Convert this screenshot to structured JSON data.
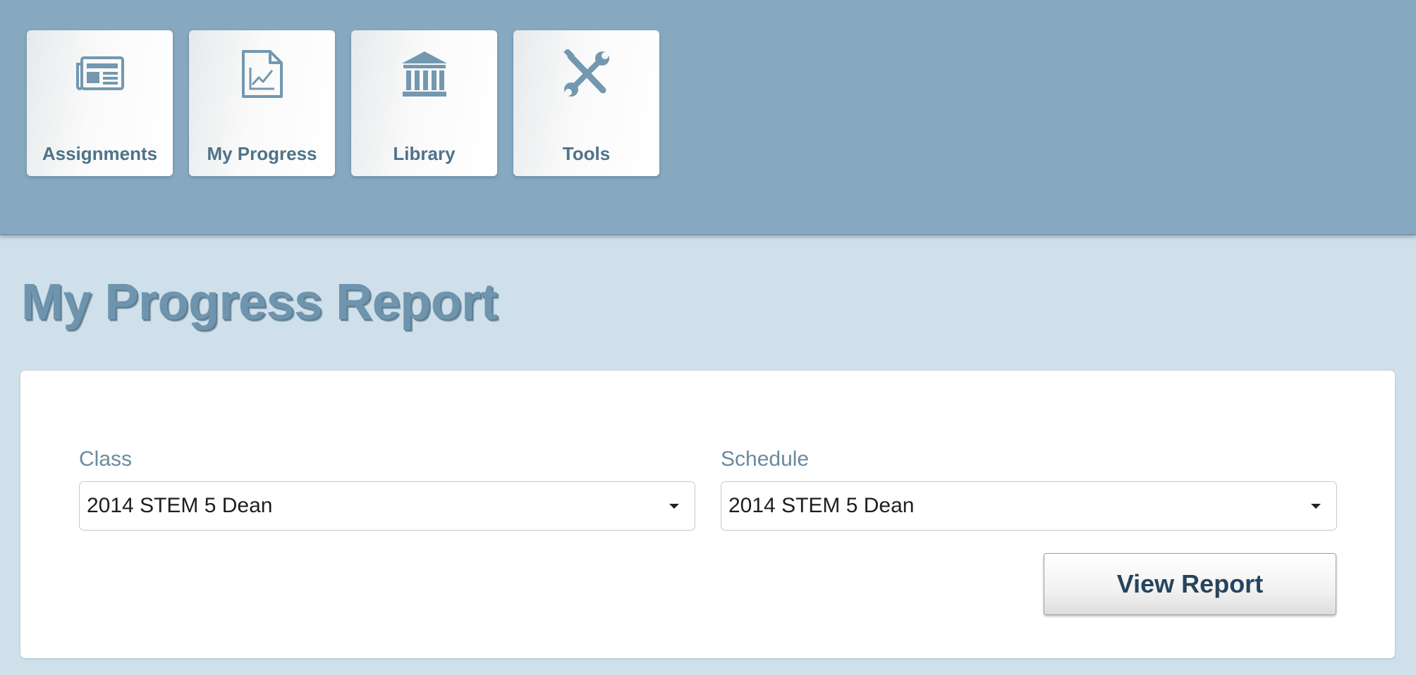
{
  "nav": {
    "tiles": [
      {
        "label": "Assignments",
        "icon": "newspaper-icon"
      },
      {
        "label": "My Progress",
        "icon": "progress-chart-icon"
      },
      {
        "label": "Library",
        "icon": "library-building-icon"
      },
      {
        "label": "Tools",
        "icon": "wrench-screwdriver-icon"
      }
    ]
  },
  "page": {
    "title": "My Progress Report"
  },
  "form": {
    "class_label": "Class",
    "class_value": "2014 STEM 5 Dean",
    "schedule_label": "Schedule",
    "schedule_value": "2014 STEM 5 Dean",
    "view_report_label": "View Report"
  },
  "colors": {
    "header_bg": "#87a9c0",
    "page_bg": "#cfe0ea",
    "accent": "#6f95ae",
    "button_text": "#26445c"
  }
}
